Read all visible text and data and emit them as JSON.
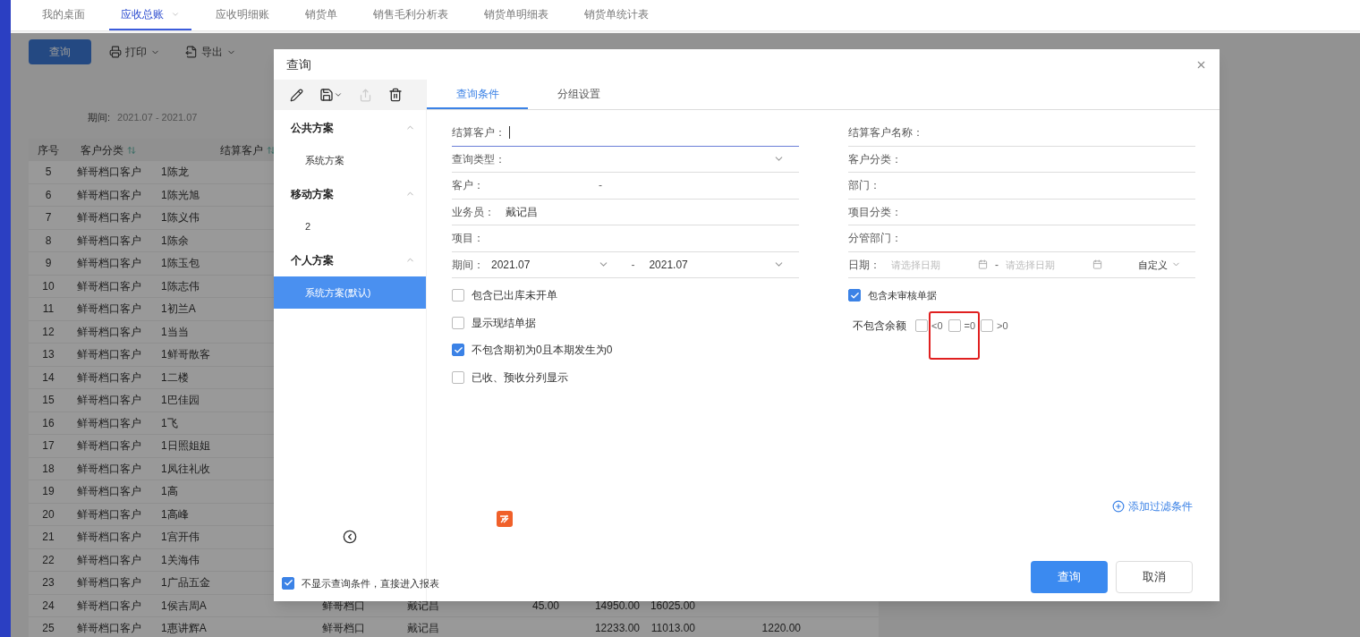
{
  "app_tabs": [
    {
      "label": "我的桌面",
      "selected": false
    },
    {
      "label": "应收总账",
      "selected": true
    },
    {
      "label": "应收明细账",
      "selected": false
    },
    {
      "label": "销货单",
      "selected": false
    },
    {
      "label": "销售毛利分析表",
      "selected": false
    },
    {
      "label": "销货单明细表",
      "selected": false
    },
    {
      "label": "销货单统计表",
      "selected": false
    }
  ],
  "toolbar": [
    {
      "label": "查询",
      "kind": "primary"
    },
    {
      "label": "打印",
      "kind": "print"
    },
    {
      "label": "导出",
      "kind": "export"
    }
  ],
  "period": {
    "label": "期间:",
    "value": "2021.07 - 2021.07"
  },
  "table": {
    "columns": [
      "序号",
      "客户分类",
      "结算客户"
    ],
    "rows": [
      {
        "cells": [
          "5",
          "鲜哥档口客户",
          "1陈龙"
        ]
      },
      {
        "cells": [
          "6",
          "鲜哥档口客户",
          "1陈光旭"
        ]
      },
      {
        "cells": [
          "7",
          "鲜哥档口客户",
          "1陈义伟"
        ]
      },
      {
        "cells": [
          "8",
          "鲜哥档口客户",
          "1陈余"
        ]
      },
      {
        "cells": [
          "9",
          "鲜哥档口客户",
          "1陈玉包"
        ]
      },
      {
        "cells": [
          "10",
          "鲜哥档口客户",
          "1陈志伟"
        ]
      },
      {
        "cells": [
          "11",
          "鲜哥档口客户",
          "1初兰A"
        ]
      },
      {
        "cells": [
          "12",
          "鲜哥档口客户",
          "1当当"
        ]
      },
      {
        "cells": [
          "13",
          "鲜哥档口客户",
          "1鲜哥散客"
        ]
      },
      {
        "cells": [
          "14",
          "鲜哥档口客户",
          "1二楼"
        ]
      },
      {
        "cells": [
          "15",
          "鲜哥档口客户",
          "1巴佳园"
        ]
      },
      {
        "cells": [
          "16",
          "鲜哥档口客户",
          "1飞"
        ]
      },
      {
        "cells": [
          "17",
          "鲜哥档口客户",
          "1日照姐姐"
        ]
      },
      {
        "cells": [
          "18",
          "鲜哥档口客户",
          "1凤往礼收"
        ]
      },
      {
        "cells": [
          "19",
          "鲜哥档口客户",
          "1高"
        ]
      },
      {
        "cells": [
          "20",
          "鲜哥档口客户",
          "1高峰"
        ]
      },
      {
        "cells": [
          "21",
          "鲜哥档口客户",
          "1宫开伟"
        ]
      },
      {
        "cells": [
          "22",
          "鲜哥档口客户",
          "1关海伟"
        ]
      },
      {
        "cells": [
          "23",
          "鲜哥档口客户",
          "1广品五金"
        ]
      },
      {
        "cells": [
          "24",
          "鲜哥档口客户",
          "1侯吉周A",
          "鲜哥档口",
          "戴记昌",
          "45.00",
          "14950.00",
          "16025.00",
          ""
        ]
      },
      {
        "cells": [
          "25",
          "鲜哥档口客户",
          "1惠讲辉A",
          "鲜哥档口",
          "戴记昌",
          "",
          "12233.00",
          "11013.00",
          "1220.00"
        ]
      }
    ]
  },
  "dialog": {
    "title": "查询",
    "schemes": [
      {
        "title": "公共方案",
        "expanded": true,
        "items": [
          {
            "label": "系统方案",
            "selected": false
          }
        ]
      },
      {
        "title": "移动方案",
        "expanded": true,
        "items": [
          {
            "label": "2",
            "selected": false
          }
        ]
      },
      {
        "title": "个人方案",
        "expanded": true,
        "items": [
          {
            "label": "系统方案(默认)",
            "selected": true
          }
        ]
      }
    ],
    "tabs": [
      {
        "label": "查询条件",
        "selected": true
      },
      {
        "label": "分组设置",
        "selected": false
      }
    ],
    "left_fields": [
      {
        "kind": "text",
        "label": "结算客户：",
        "focused": true
      },
      {
        "kind": "select",
        "label": "查询类型："
      },
      {
        "kind": "range",
        "label": "客户：",
        "separator": "-"
      },
      {
        "kind": "text",
        "label": "业务员：",
        "value": "戴记昌",
        "focused": false
      },
      {
        "kind": "text",
        "label": "项目：",
        "focused": false
      },
      {
        "kind": "period",
        "label": "期间：",
        "from": "2021.07",
        "separator": "-",
        "to": "2021.07"
      }
    ],
    "left_checks": [
      {
        "label": "包含已出库未开单",
        "checked": false
      },
      {
        "label": "显示现结单据",
        "checked": false
      },
      {
        "label": "不包含期初为0且本期发生为0",
        "checked": true
      },
      {
        "label": "已收、预收分列显示",
        "checked": false
      }
    ],
    "right_fields": [
      {
        "kind": "text",
        "label": "结算客户名称："
      },
      {
        "kind": "text",
        "label": "客户分类："
      },
      {
        "kind": "text",
        "label": "部门："
      },
      {
        "kind": "text",
        "label": "项目分类："
      },
      {
        "kind": "text",
        "label": "分管部门："
      },
      {
        "kind": "date",
        "label": "日期：",
        "from_placeholder": "请选择日期",
        "separator": "-",
        "to_placeholder": "请选择日期",
        "mode": "自定义"
      }
    ],
    "right_check": {
      "label": "包含未审核单据",
      "checked": true
    },
    "balance": {
      "label": "不包含余额",
      "options": [
        {
          "label": "<0",
          "checked": false,
          "highlighted": false
        },
        {
          "label": "=0",
          "checked": false,
          "highlighted": true
        },
        {
          "label": ">0",
          "checked": false,
          "highlighted": false
        }
      ]
    },
    "add_filter": "添加过滤条件",
    "skip_check": {
      "label": "不显示查询条件，直接进入报表",
      "checked": true
    },
    "buttons": [
      {
        "label": "查询",
        "kind": "primary"
      },
      {
        "label": "取消",
        "kind": "secondary"
      }
    ]
  }
}
